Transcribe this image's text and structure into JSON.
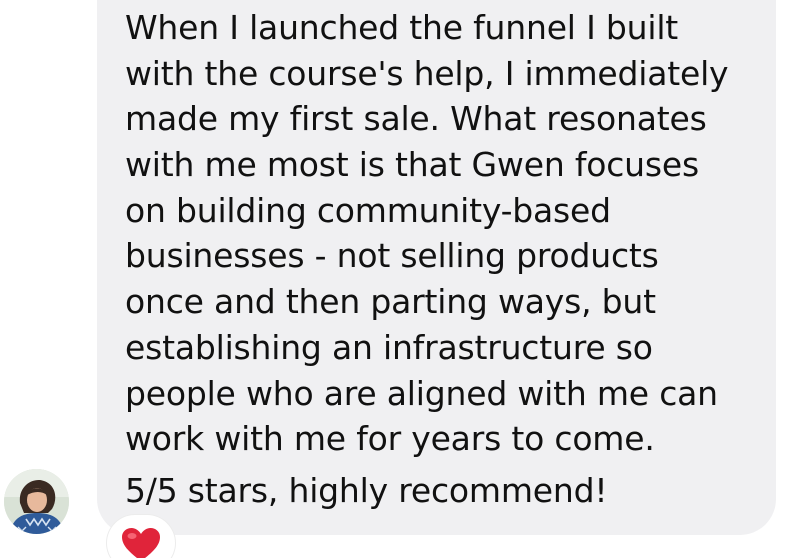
{
  "message": {
    "lines": [
      "When I launched the funnel I built",
      "with the course's help, I immediately",
      "made my first sale. What resonates",
      "with me most is that Gwen focuses",
      "on building community-based",
      "businesses - not selling products",
      "once and then parting ways, but",
      "establishing an infrastructure so",
      "people who are aligned with me can",
      "work with me for years to come."
    ],
    "rating_line": "5/5 stars, highly recommend!"
  },
  "reaction": {
    "icon": "heart-icon",
    "color": "#e0243a"
  },
  "avatar": {
    "icon": "profile-photo"
  },
  "colors": {
    "bubble": "#f0f0f2",
    "text": "#111111"
  }
}
